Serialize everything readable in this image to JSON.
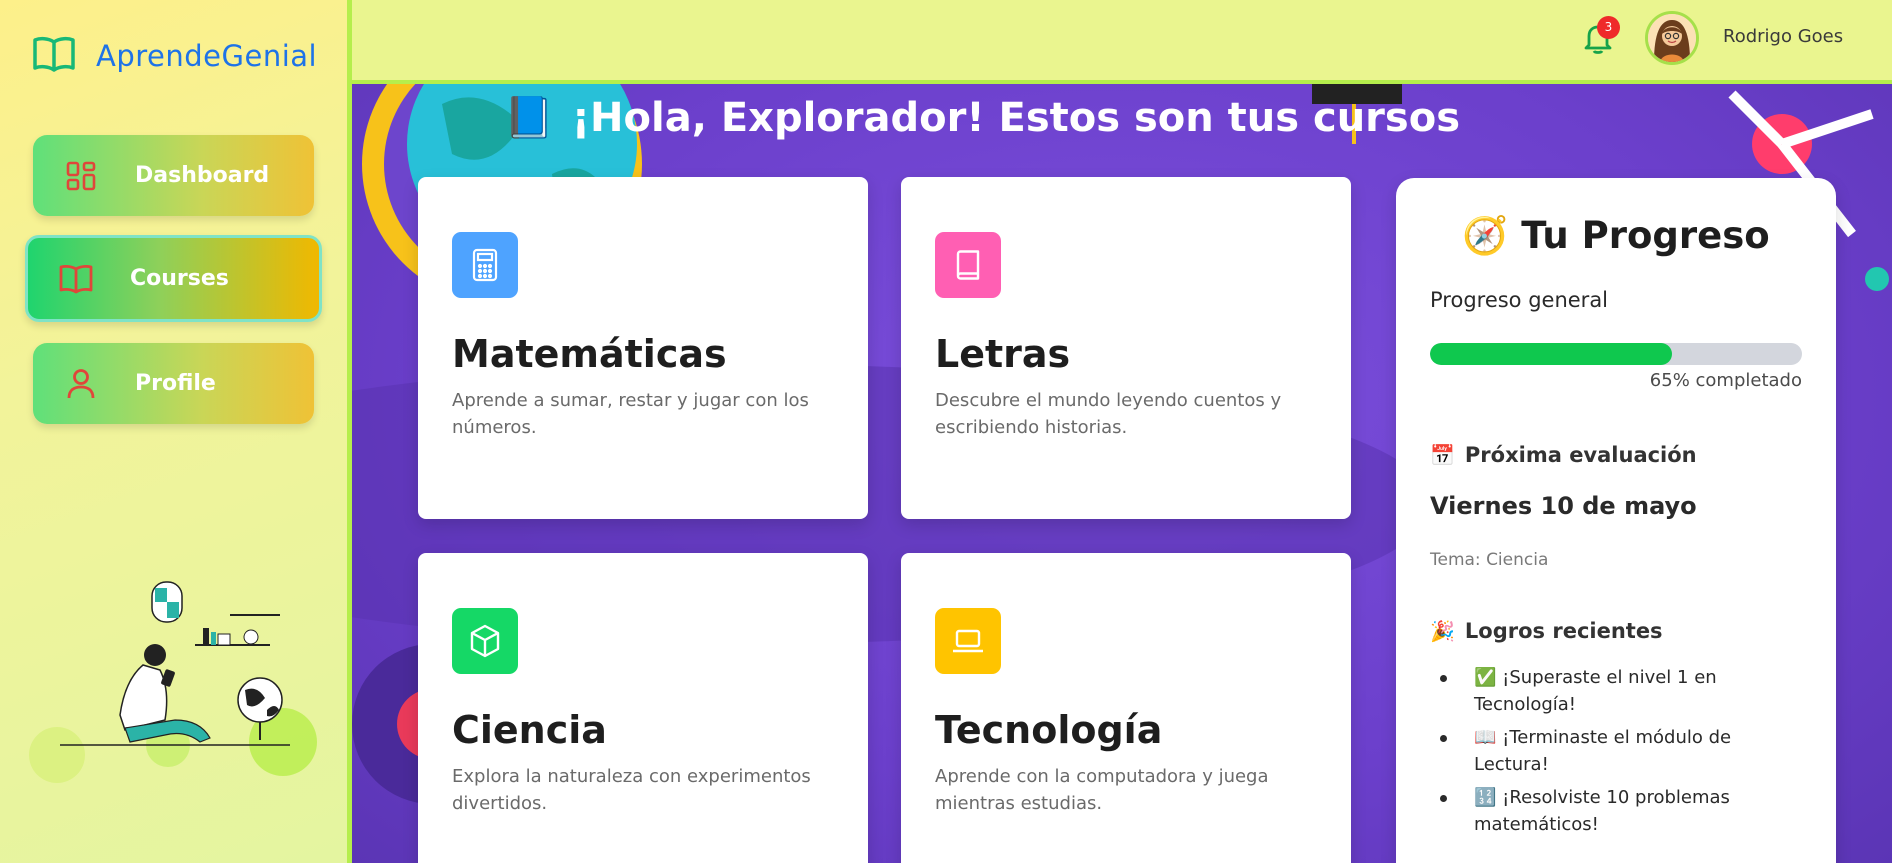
{
  "brand": {
    "name": "AprendeGenial",
    "icon": "open-book-icon",
    "color": "#1e73e8"
  },
  "sidebar": {
    "items": [
      {
        "label": "Dashboard",
        "icon": "grid-icon",
        "active": false
      },
      {
        "label": "Courses",
        "icon": "open-book-icon",
        "active": true
      },
      {
        "label": "Profile",
        "icon": "user-icon",
        "active": false
      }
    ]
  },
  "topbar": {
    "notifications": {
      "icon": "bell-icon",
      "count": "3"
    },
    "user": {
      "name": "Rodrigo Goes",
      "avatar": "avatar-icon"
    }
  },
  "main": {
    "heading_icon": "📘",
    "heading": "¡Hola, Explorador! Estos son tus cursos",
    "courses": [
      {
        "title": "Matemáticas",
        "description": "Aprende a sumar, restar y jugar con los números.",
        "icon": "calculator-icon",
        "color": "#4ea3ff"
      },
      {
        "title": "Letras",
        "description": "Descubre el mundo leyendo cuentos y escribiendo historias.",
        "icon": "book-icon",
        "color": "#ff5fb3"
      },
      {
        "title": "Ciencia",
        "description": "Explora la naturaleza con experimentos divertidos.",
        "icon": "cube-icon",
        "color": "#15d866"
      },
      {
        "title": "Tecnología",
        "description": "Aprende con la computadora y juega mientras estudias.",
        "icon": "laptop-icon",
        "color": "#ffc400"
      }
    ]
  },
  "progress": {
    "title": "Tu Progreso",
    "title_icon": "🧭",
    "general_label": "Progreso general",
    "percent": 65,
    "percent_text": "65% completado",
    "bar_color": "#0fc84e",
    "next_eval_label": "Próxima evaluación",
    "next_eval_icon": "📅",
    "next_eval_date": "Viernes 10 de mayo",
    "next_eval_topic": "Tema: Ciencia",
    "achievements_label": "Logros recientes",
    "achievements_icon": "🎉",
    "achievements": [
      {
        "icon": "✅",
        "text": "¡Superaste el nivel 1 en Tecnología!"
      },
      {
        "icon": "📖",
        "text": "¡Terminaste el módulo de Lectura!"
      },
      {
        "icon": "🔢",
        "text": "¡Resolviste 10 problemas matemáticos!"
      }
    ]
  }
}
